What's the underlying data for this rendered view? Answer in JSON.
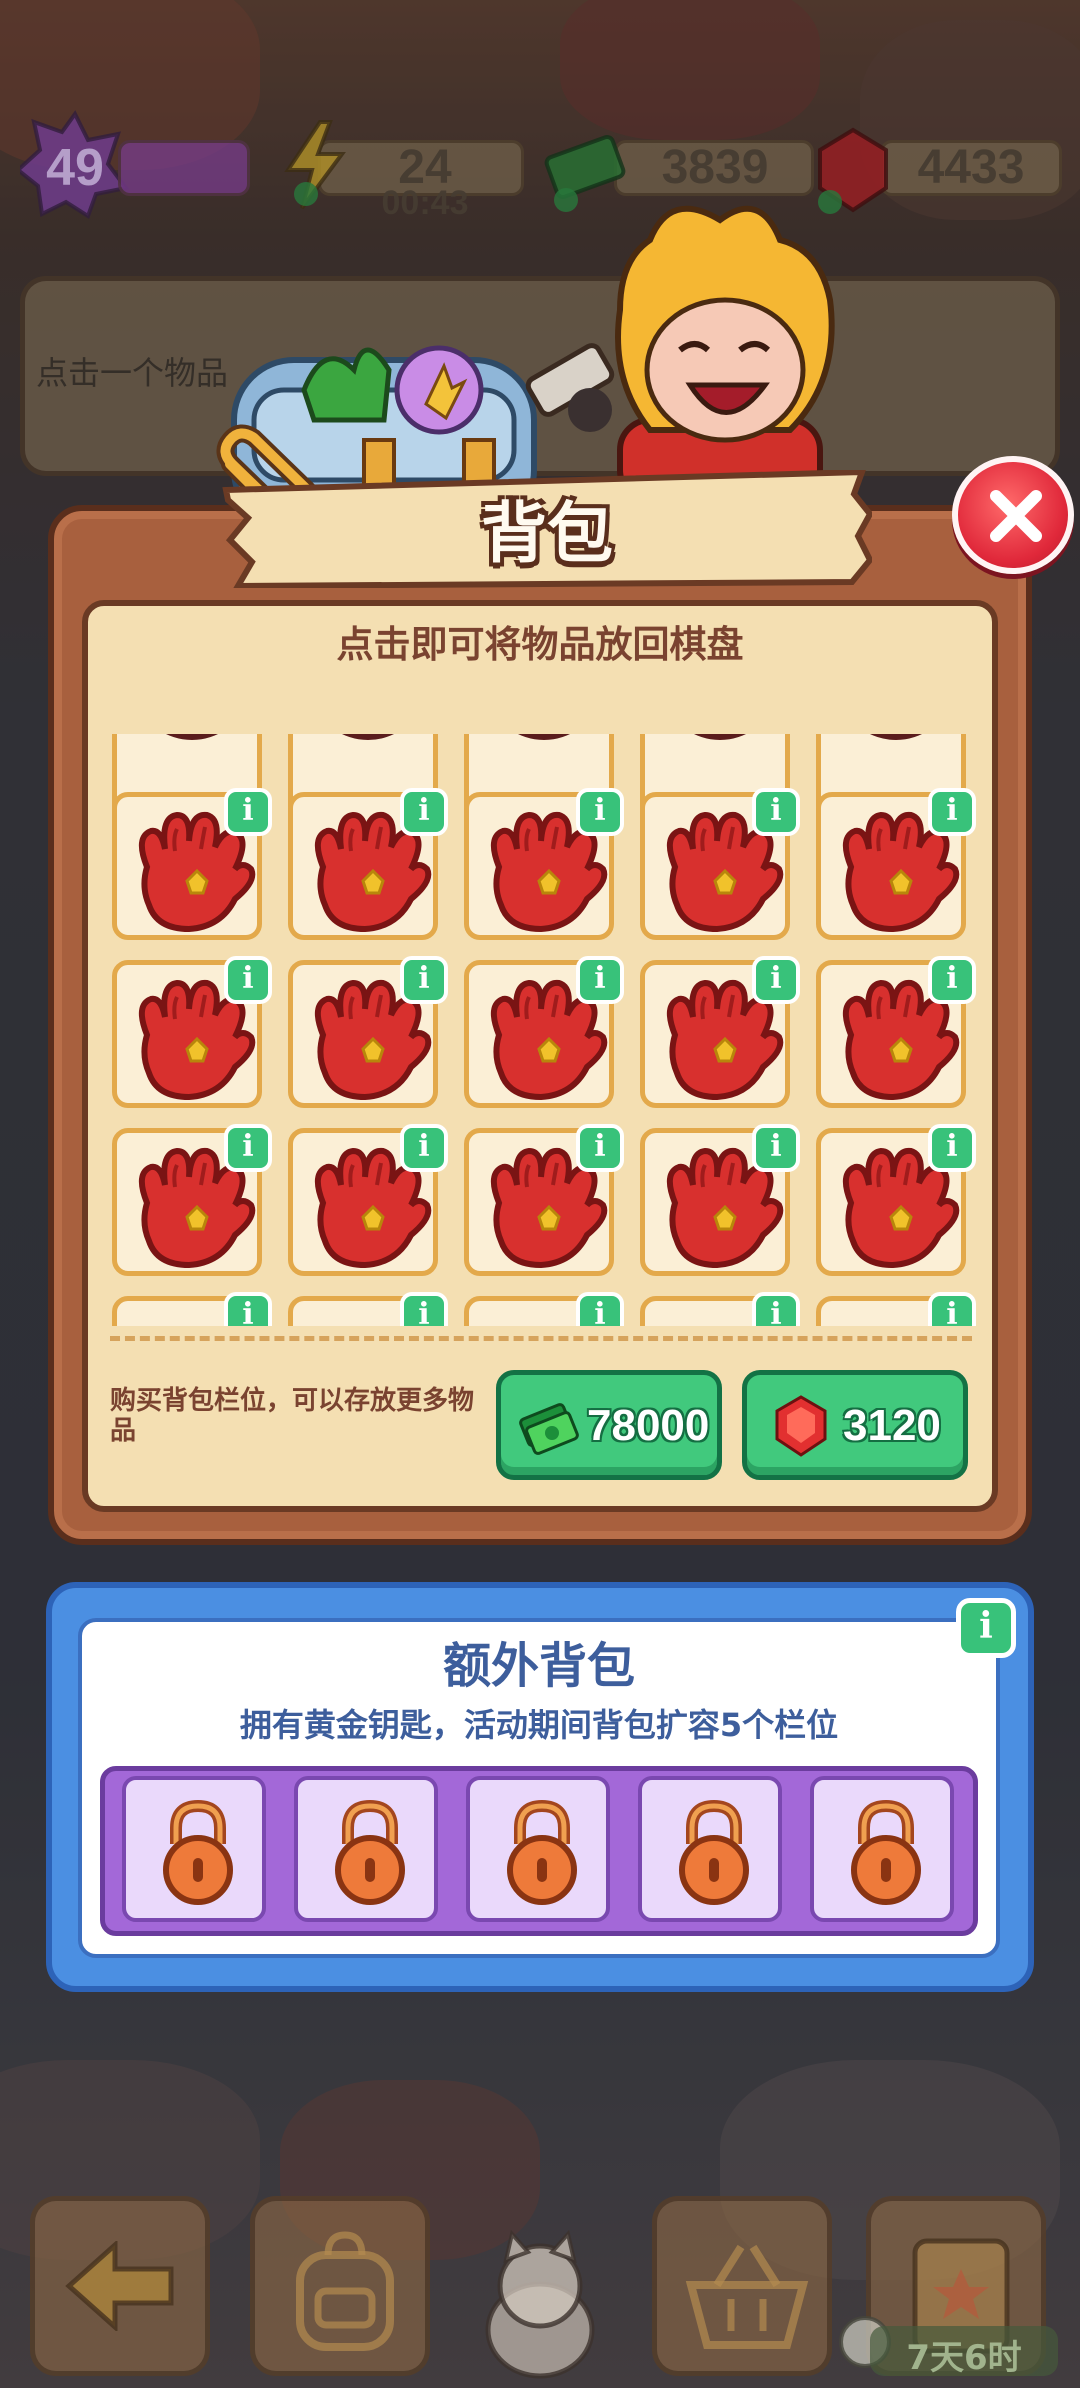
{
  "hud": {
    "level": "49",
    "energy": "24",
    "energy_timer": "00:43",
    "cash": "3839",
    "gems": "4433"
  },
  "hint": {
    "text": "点击一个物品"
  },
  "backpack": {
    "title": "背包",
    "subtitle": "点击即可将物品放回棋盘",
    "item_name": "red-glove",
    "info_label": "i",
    "buy_text": "购买背包栏位，可以存放更多物品",
    "buy_cash_price": "78000",
    "buy_gem_price": "3120"
  },
  "extra_backpack": {
    "title": "额外背包",
    "description": "拥有黄金钥匙，活动期间背包扩容5个栏位",
    "info_label": "i"
  },
  "bottom_bar": {
    "timer": "7天6时"
  },
  "colors": {
    "panel": "#a8603e",
    "panel_inner": "#f4dfb2",
    "buy_button": "#41c97d",
    "extra_panel": "#4b8fe2",
    "lock_slot": "#ead9fb",
    "close_button": "#e0283a"
  }
}
